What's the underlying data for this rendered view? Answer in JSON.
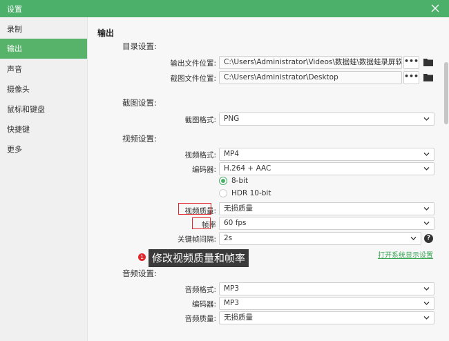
{
  "window": {
    "title": "设置"
  },
  "sidebar": {
    "items": [
      {
        "label": "录制"
      },
      {
        "label": "输出"
      },
      {
        "label": "声音"
      },
      {
        "label": "摄像头"
      },
      {
        "label": "鼠标和键盘"
      },
      {
        "label": "快捷键"
      },
      {
        "label": "更多"
      }
    ],
    "active": "输出"
  },
  "main": {
    "section_title": "输出",
    "directory": {
      "title": "目录设置:",
      "output_label": "输出文件位置:",
      "output_value": "C:\\Users\\Administrator\\Videos\\数据蛙\\数据蛙录屏软件",
      "screenshot_label": "截图文件位置:",
      "screenshot_value": "C:\\Users\\Administrator\\Desktop",
      "browse": "•••"
    },
    "screenshot": {
      "title": "截图设置:",
      "format_label": "截图格式:",
      "format_value": "PNG"
    },
    "video": {
      "title": "视频设置:",
      "format_label": "视频格式:",
      "format_value": "MP4",
      "encoder_label": "编码器:",
      "encoder_value": "H.264 + AAC",
      "bitdepth_options": [
        "8-bit",
        "HDR 10-bit"
      ],
      "bitdepth_selected": "8-bit",
      "quality_label": "视频质量:",
      "quality_value": "无损质量",
      "framerate_label": "帧率",
      "framerate_value": "60 fps",
      "keyframe_label": "关键帧间隔:",
      "keyframe_value": "2s",
      "help": "?"
    },
    "annotation": {
      "badge": "1",
      "text": "修改视频质量和帧率"
    },
    "display_link": "打开系统显示设置",
    "audio": {
      "title": "音频设置:",
      "format_label": "音频格式:",
      "format_value": "MP3",
      "encoder_label": "编码器:",
      "encoder_value": "MP3",
      "quality_label": "音频质量:",
      "quality_value": "无损质量"
    }
  },
  "colors": {
    "accent": "#4caf6a",
    "highlight": "#e0262b"
  }
}
